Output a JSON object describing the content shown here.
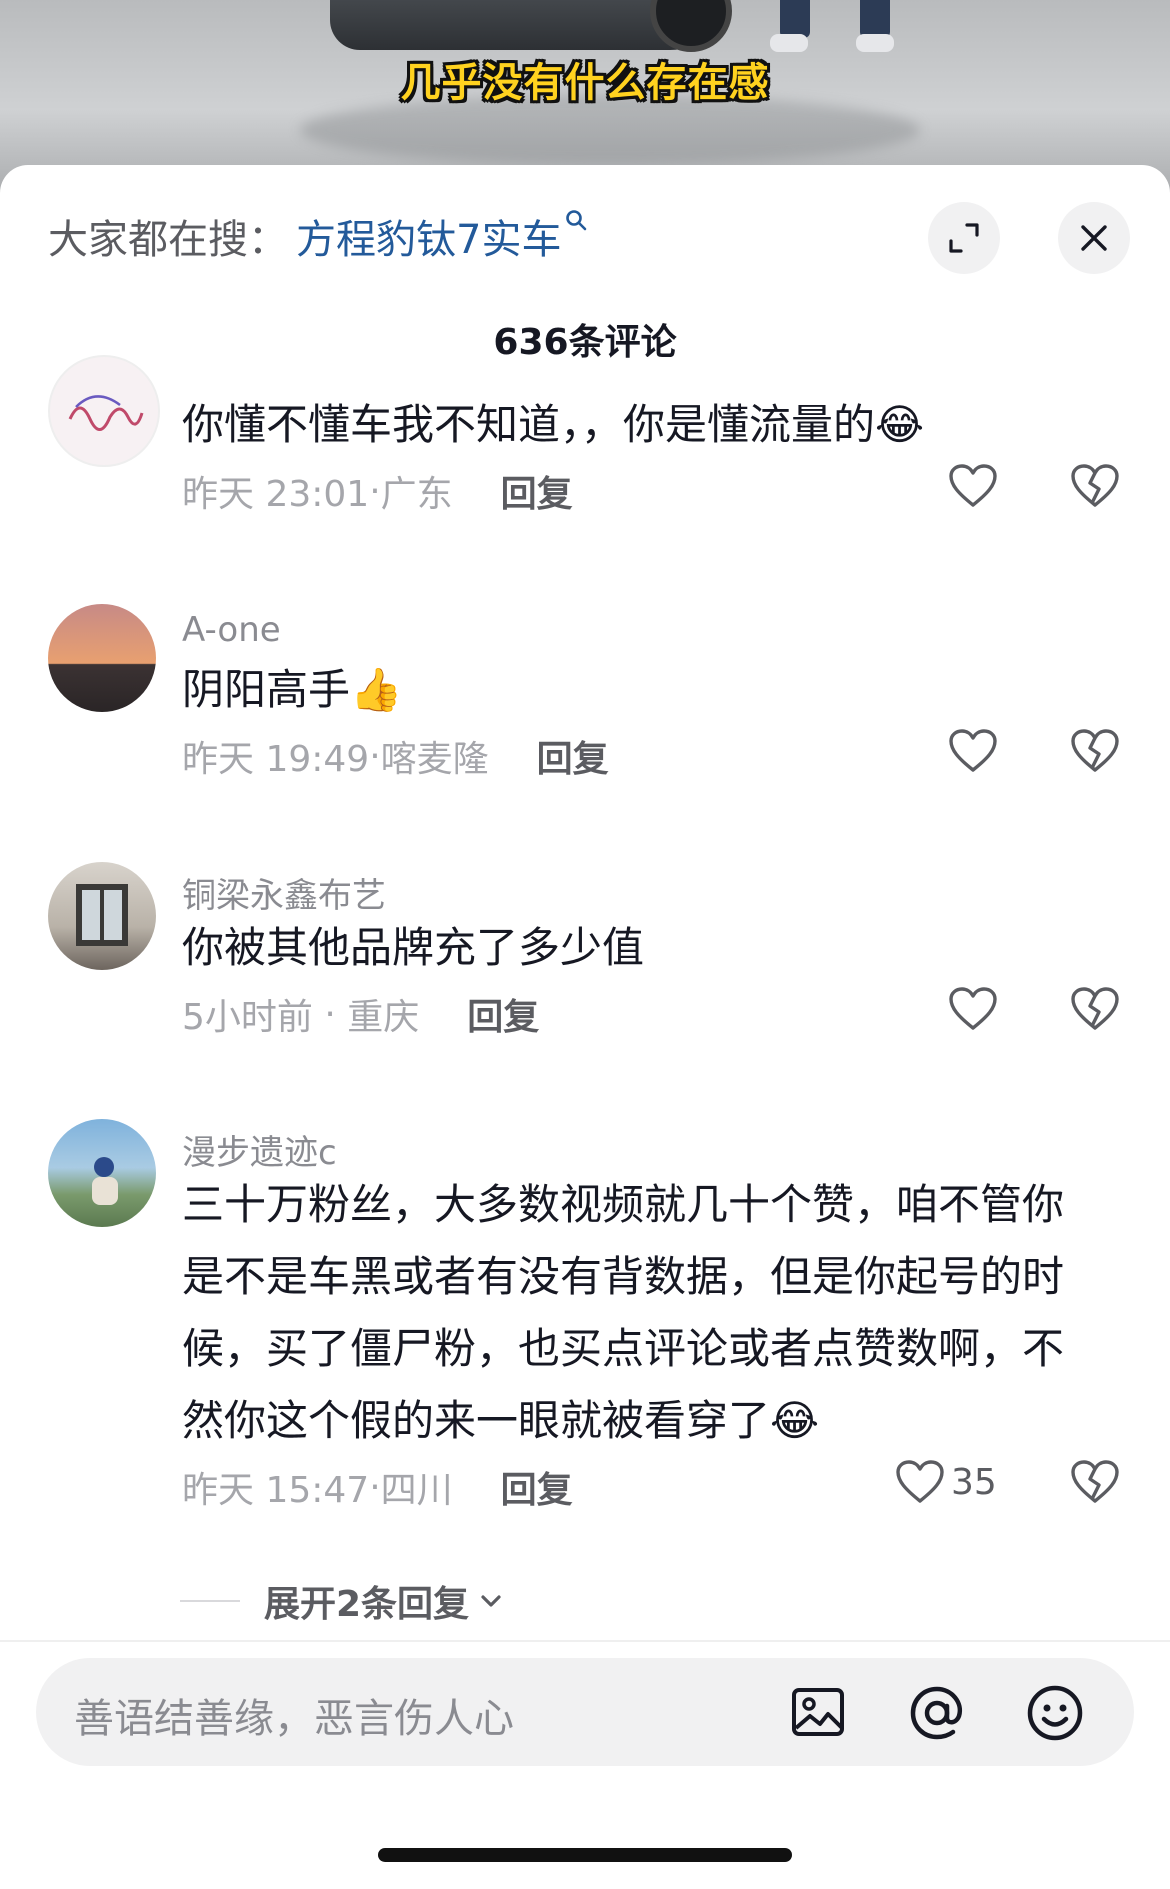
{
  "video": {
    "subtitle": "几乎没有什么存在感"
  },
  "header": {
    "search_prefix": "大家都在搜：",
    "search_term": "方程豹钛7实车",
    "title": "636条评论"
  },
  "comments": [
    {
      "username": "",
      "text": "你懂不懂车我不知道，，你是懂流量的",
      "emoji": "😂",
      "time": "昨天 23:01",
      "location": "广东",
      "reply_label": "回复",
      "likes": ""
    },
    {
      "username": "A-one",
      "text": "阴阳高手",
      "emoji": "👍",
      "time": "昨天 19:49",
      "location": "喀麦隆",
      "reply_label": "回复",
      "likes": ""
    },
    {
      "username": "铜梁永鑫布艺",
      "text": "你被其他品牌充了多少值",
      "emoji": "",
      "time": "5小时前",
      "location": "重庆",
      "reply_label": "回复",
      "likes": ""
    },
    {
      "username": "漫步遗迹c",
      "text": "三十万粉丝，大多数视频就几十个赞，咱不管你是不是车黑或者有没有背数据，但是你起号的时候，买了僵尸粉，也买点评论或者点赞数啊，不然你这个假的来一眼就被看穿了",
      "emoji": "😂",
      "time": "昨天 15:47",
      "location": "四川",
      "reply_label": "回复",
      "likes": "35"
    }
  ],
  "expand_replies": "展开2条回复",
  "input": {
    "placeholder": "善语结善缘，恶言伤人心"
  },
  "colors": {
    "search_link": "#235a9a",
    "subtitle_yellow": "#ffd21f",
    "meta_gray": "#a5a6ab"
  },
  "icons": [
    "expand-icon",
    "close-icon",
    "heart-icon",
    "dislike-icon",
    "image-icon",
    "at-icon",
    "emoji-icon",
    "chevron-down-icon",
    "search-icon"
  ]
}
